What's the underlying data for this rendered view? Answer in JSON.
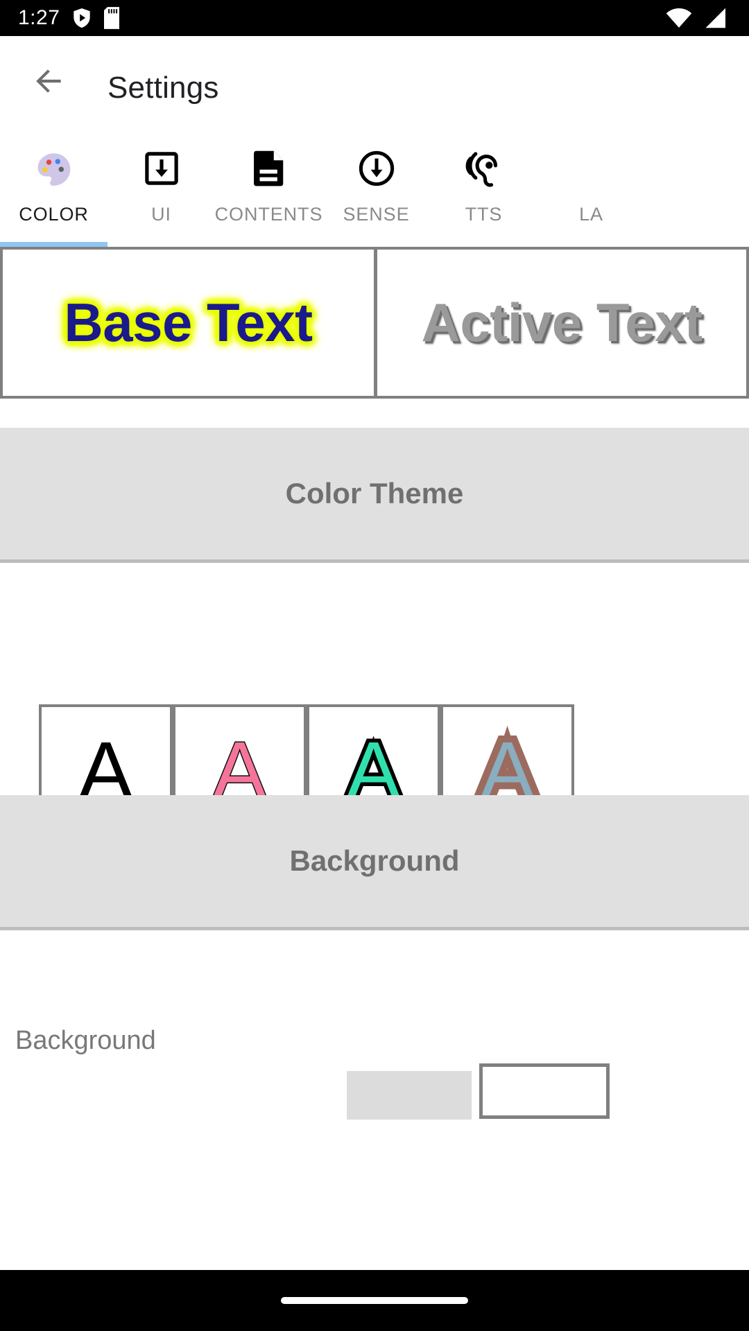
{
  "status_bar": {
    "time": "1:27",
    "left_icons": [
      "play-protect-shield-icon",
      "sd-card-icon"
    ],
    "right_icons": [
      "wifi-icon",
      "cellular-signal-icon"
    ]
  },
  "app_bar": {
    "back_icon": "back-arrow-icon",
    "title": "Settings"
  },
  "tabs": {
    "active_index": 0,
    "items": [
      {
        "label": "COLOR",
        "icon": "palette-icon"
      },
      {
        "label": "UI",
        "icon": "download-box-icon"
      },
      {
        "label": "CONTENTS",
        "icon": "document-icon"
      },
      {
        "label": "SENSE",
        "icon": "circle-down-arrow-icon"
      },
      {
        "label": "TTS",
        "icon": "ear-sound-icon"
      },
      {
        "label": "LA",
        "icon": "language-icon"
      }
    ]
  },
  "preview": {
    "base_text": "Base Text",
    "active_text": "Active Text",
    "base_text_color": "#1a1a8c",
    "base_glow_color": "#eaff00",
    "active_text_color": "#9a9a9a",
    "active_shadow_color": "#6e6e6e",
    "frame_color": "#808080"
  },
  "sections": [
    {
      "title": "Color Theme"
    },
    {
      "title": "Background"
    }
  ],
  "color_theme": {
    "swatches": [
      {
        "glyph": "A",
        "fill": "#000000",
        "outline": "none"
      },
      {
        "glyph": "A",
        "fill": "#f5749a",
        "outline": "#111111"
      },
      {
        "glyph": "A",
        "fill": "#2fe0ae",
        "outline": "#000000"
      },
      {
        "glyph": "A",
        "fill": "#89aec0",
        "outline": "#9c6b5f"
      }
    ]
  },
  "background_setting": {
    "label": "Background",
    "preview_gray": "#dcdcdc",
    "preview_white": "#ffffff"
  },
  "nav_bar": {
    "handle": "home-gesture-pill"
  }
}
